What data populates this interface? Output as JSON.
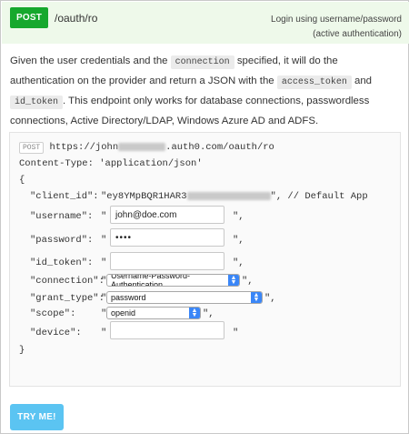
{
  "endpoint": {
    "method": "POST",
    "path": "/oauth/ro",
    "summary_line1": "Login using username/password",
    "summary_line2": "(active authentication)"
  },
  "description": {
    "p1": "Given the user credentials and the ",
    "code1": "connection",
    "p2": " specified, it will do the authentication on the provider and return a JSON with the ",
    "code2": "access_token",
    "p3": " and ",
    "code3": "id_token",
    "p4": ". This endpoint only works for database connections, passwordless connections, Active Directory/LDAP, Windows Azure AD and ADFS."
  },
  "request": {
    "method_badge": "POST",
    "url_prefix": "https://john",
    "url_suffix": ".auth0.com/oauth/ro",
    "content_type": "Content-Type: 'application/json'",
    "open_brace": "{",
    "close_brace": "}",
    "client_id_key": "\"client_id\":",
    "client_id_value": "\"ey8YMpBQR1HAR3",
    "client_id_comment": "\", // Default App",
    "username_key": "\"username\":",
    "username_value": "john@doe.com",
    "password_key": "\"password\":",
    "password_value": "••••",
    "id_token_key": "\"id_token\":",
    "id_token_value": "",
    "connection_key": "\"connection\":",
    "connection_value": "Username-Password-Authentication",
    "grant_type_key": "\"grant_type\":",
    "grant_type_value": "password",
    "scope_key": "\"scope\":",
    "scope_value": "openid",
    "device_key": "\"device\":",
    "device_value": "",
    "quote_open": "\"",
    "quote_close_comma": "\",",
    "quote_close": "\""
  },
  "try_button": "TRY ME!",
  "colors": {
    "post_green": "#16a82d",
    "header_bg": "#eef9ea",
    "try_blue": "#5bc4f2",
    "select_caret": "#3a86f7"
  }
}
